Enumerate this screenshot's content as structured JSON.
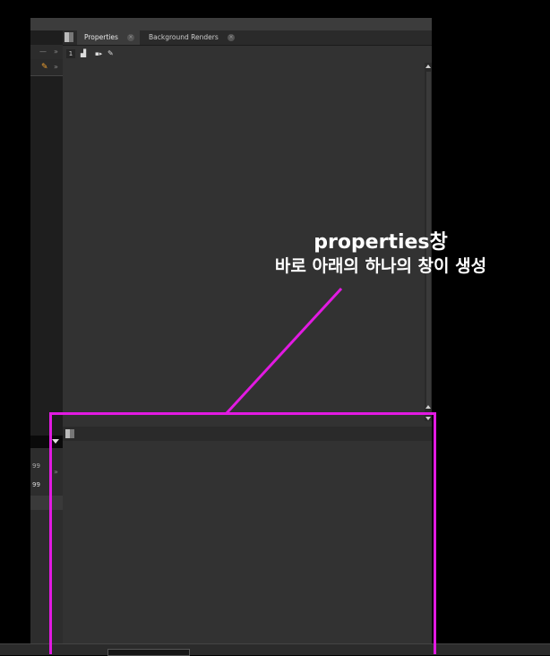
{
  "tabs": [
    {
      "label": "Properties",
      "active": true
    },
    {
      "label": "Background Renders",
      "active": false
    }
  ],
  "toolbar": {
    "viewer_count": "1"
  },
  "left_panel": {
    "value1": "99",
    "value2": "99"
  },
  "annotation": {
    "line1": "properties창",
    "line2": "바로 아래의 하나의 창이 생성",
    "color": "#e21ae2"
  },
  "colors": {
    "panel_bg": "#323232",
    "tabbar_bg": "#2a2a2a",
    "accent_pencil": "#f0a030"
  },
  "icons": [
    "lock-icon",
    "node-graph-icon",
    "clear-pencil-icon",
    "scroll-up-icon",
    "scroll-down-icon",
    "dropdown-arrow-icon",
    "panel-grip-icon",
    "tab-close-icon"
  ]
}
